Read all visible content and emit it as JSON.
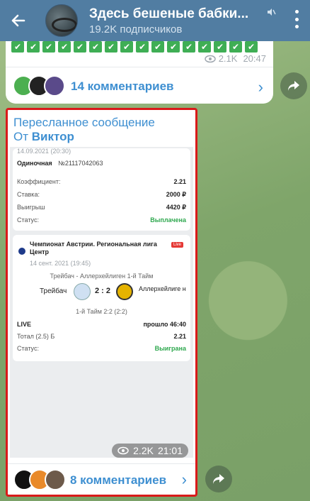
{
  "header": {
    "title": "Здесь бешеные бабки...",
    "subtitle": "19.2K подписчиков"
  },
  "post1": {
    "views": "2.1K",
    "time": "20:47",
    "comments_label": "14 комментариев"
  },
  "post2": {
    "forwarded_label": "Пересланное сообщение",
    "from_prefix": "От",
    "from_name": "Виктор",
    "views": "2.2K",
    "time": "21:01",
    "comments_label": "8 комментариев",
    "bet": {
      "date": "14.09.2021 (20:30)",
      "type": "Одиночная",
      "number": "№21117042063",
      "rows": [
        {
          "label": "Коэффициент:",
          "value": "2.21"
        },
        {
          "label": "Ставка:",
          "value": "2000 ₽"
        },
        {
          "label": "Выигрыш",
          "value": "4420 ₽"
        },
        {
          "label": "Статус:",
          "value": "Выплачена"
        }
      ]
    },
    "match": {
      "league": "Чемпионат Австрии. Региональная лига Центр",
      "live_badge": "Live",
      "date": "14 сент. 2021 (19:45)",
      "event": "Трейбач - Аллерхейлиген 1-й Тайм",
      "home": "Трейбач",
      "score": "2 : 2",
      "away": "Аллерхейлиге н",
      "half": "1-й Тайм 2:2 (2:2)",
      "rows": [
        {
          "label": "LIVE",
          "value": "прошло 46:40"
        },
        {
          "label": "Тотал (2.5) Б",
          "value": "2.21"
        },
        {
          "label": "Статус:",
          "value": "Выиграна"
        }
      ]
    }
  },
  "colors": {
    "header": "#517da2",
    "accent": "#3e8fd1",
    "highlight_border": "#d91a1a",
    "win_green": "#2fa84f"
  }
}
